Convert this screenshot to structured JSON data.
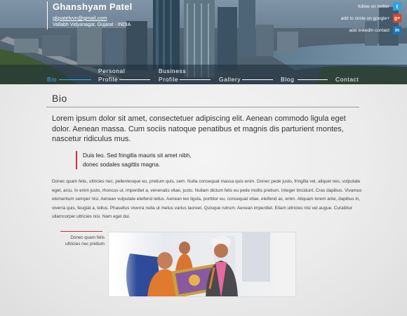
{
  "profile": {
    "name": "Ghanshyam Patel",
    "email": "gkpatelvvn@gmail.com",
    "location": "Vallabh Vidyanagar, Gujarat - INDIA"
  },
  "social": [
    {
      "label": "follow on twitter",
      "icon": "twitter-icon",
      "glyph": "t",
      "color": "#2aa3e0"
    },
    {
      "label": "add to circle on google+",
      "icon": "google-plus-icon",
      "glyph": "g+",
      "color": "#d6452f"
    },
    {
      "label": "add linkedin contact",
      "icon": "linkedin-icon",
      "glyph": "in",
      "color": "#1877b5"
    }
  ],
  "nav": [
    {
      "label": "Bio",
      "active": true
    },
    {
      "label_line1": "Personal",
      "label_line2": "Profile"
    },
    {
      "label_line1": "Business",
      "label_line2": "Profile"
    },
    {
      "label": "Gallery"
    },
    {
      "label": "Blog"
    },
    {
      "label": "Contact"
    }
  ],
  "accent_color": "#31b8ff",
  "quote_color": "#c83232",
  "bio": {
    "title": "Bio",
    "lead": "Lorem ipsum dolor sit amet, consectetuer adipiscing elit. Aenean commodo ligula eget dolor. Aenean massa. Cum sociis natoque penatibus et magnis dis parturient montes, nascetur ridiculus mus.",
    "quote_line1": "Duis leo. Sed fringilla mauris sit amet nibh,",
    "quote_line2": "donec sodales sagittis magna.",
    "body": "Donec quam felis, ultricies nec, pellentesque eu, pretium quis, sem. Nulla consequat massa quis enim. Donec pede justo, fringilla vel, aliquet nec, vulputate eget, arcu. In enim justo, rhoncus ut, imperdiet a, venenatis vitae, justo. Nullam dictum felis eu pede mollis pretium. Integer tincidunt. Cras dapibus. Vivamus elementum semper nisi. Aenean vulputate eleifend tellus. Aenean leo ligula, porttitor eu, consequat vitae, eleifend ac, enim. Aliquam lorem ante, dapibus in, viverra quis, feugiat a, tellus. Phasellus viverra nulla ut metus varius laoreet. Quisque rutrum. Aenean imperdiet. Etiam ultricies nisi vel augue. Curabitur ullamcorper ultricies nisi. Nam eget dui.",
    "caption_line1": "Donec quam felis",
    "caption_line2": "ultricies nec pretium"
  }
}
